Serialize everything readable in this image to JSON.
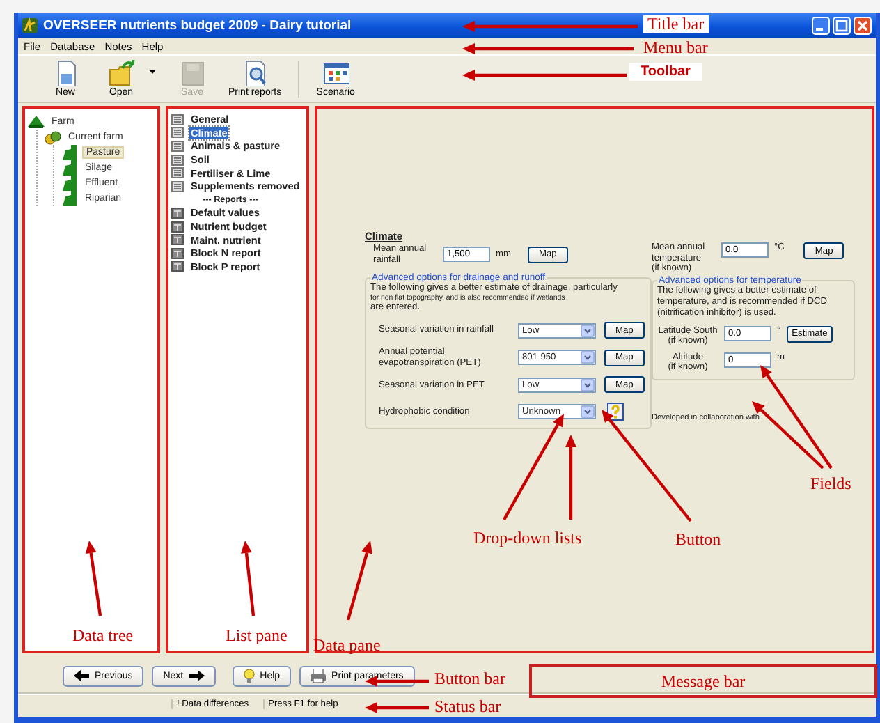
{
  "window": {
    "title": "OVERSEER nutrients budget 2009 - Dairy tutorial"
  },
  "menu": [
    "File",
    "Database",
    "Notes",
    "Help"
  ],
  "toolbar": [
    {
      "label": "New",
      "kind": "new",
      "disabled": false
    },
    {
      "label": "Open",
      "kind": "open",
      "disabled": false,
      "dropdown": true
    },
    {
      "label": "Save",
      "kind": "save",
      "disabled": true
    },
    {
      "label": "Print reports",
      "kind": "print",
      "disabled": false
    },
    {
      "label": "Scenario",
      "kind": "scenario",
      "disabled": false
    }
  ],
  "data_tree": [
    {
      "label": "Farm",
      "kind": "farm",
      "selected": false,
      "children": [
        {
          "label": "Current farm",
          "kind": "group",
          "selected": false,
          "children": [
            {
              "label": "Pasture",
              "kind": "block",
              "selected": true
            },
            {
              "label": "Silage",
              "kind": "block",
              "selected": false
            },
            {
              "label": "Effluent",
              "kind": "block",
              "selected": false
            },
            {
              "label": "Riparian",
              "kind": "block",
              "selected": false
            }
          ]
        }
      ]
    }
  ],
  "list_pane": [
    {
      "label": "General",
      "kind": "page",
      "selected": false
    },
    {
      "label": "Climate",
      "kind": "page",
      "selected": true
    },
    {
      "label": "Animals & pasture",
      "kind": "page",
      "selected": false
    },
    {
      "label": "Soil",
      "kind": "page",
      "selected": false
    },
    {
      "label": "Fertiliser & Lime",
      "kind": "page",
      "selected": false
    },
    {
      "label": "Supplements removed",
      "kind": "page",
      "selected": false
    },
    {
      "label": "--- Reports ---",
      "kind": "heading",
      "selected": false
    },
    {
      "label": "Default values",
      "kind": "report",
      "selected": false
    },
    {
      "label": "Nutrient budget",
      "kind": "report",
      "selected": false
    },
    {
      "label": "Maint. nutrient",
      "kind": "report",
      "selected": false
    },
    {
      "label": "Block N report",
      "kind": "report",
      "selected": false
    },
    {
      "label": "Block P report",
      "kind": "report",
      "selected": false
    }
  ],
  "data_pane": {
    "section_title": "Climate",
    "rainfall": {
      "label": "Mean annual rainfall",
      "value": "1,500",
      "unit": "mm",
      "button": "Map"
    },
    "drainage": {
      "legend": "Advanced options for drainage and runoff",
      "intro": "The following gives a better estimate of drainage, particularly",
      "intro_small": "for non flat topography, and is also recommended if wetlands",
      "intro_end": "are entered.",
      "rows": [
        {
          "label": "Seasonal variation in rainfall",
          "value": "Low",
          "kind": "map",
          "button": "Map"
        },
        {
          "label": "Annual potential evapotranspiration (PET)",
          "value": "801-950",
          "kind": "map",
          "button": "Map"
        },
        {
          "label": "Seasonal variation in PET",
          "value": "Low",
          "kind": "map",
          "button": "Map"
        },
        {
          "label": "Hydrophobic condition",
          "value": "Unknown",
          "kind": "help"
        }
      ]
    },
    "temperature": {
      "label": "Mean annual temperature",
      "note": "(if known)",
      "value": "0.0",
      "unit": "°C",
      "button": "Map"
    },
    "temperature_options": {
      "legend": "Advanced options for temperature",
      "intro": "The following gives a better estimate of temperature, and is recommended if DCD (nitrification inhibitor) is used.",
      "latitude": {
        "label": "Latitude South",
        "note": "(if known)",
        "value": "0.0",
        "unit": "°",
        "button": "Estimate"
      },
      "altitude": {
        "label": "Altitude",
        "note": "(if known)",
        "value": "0",
        "unit": "m"
      }
    },
    "credit": "Developed in collaboration with"
  },
  "button_bar": [
    {
      "label": "Previous",
      "kind": "previous"
    },
    {
      "label": "Next",
      "kind": "next"
    },
    {
      "label": "Help",
      "kind": "help"
    },
    {
      "label": "Print parameters",
      "kind": "print"
    }
  ],
  "status_bar": [
    "! Data differences",
    "Press F1 for help"
  ],
  "annotations": [
    {
      "label": "Title bar",
      "kind": "callout"
    },
    {
      "label": "Menu bar",
      "kind": "callout"
    },
    {
      "label": "Toolbar",
      "kind": "callout"
    },
    {
      "label": "Data tree",
      "kind": "callout"
    },
    {
      "label": "List pane",
      "kind": "callout"
    },
    {
      "label": "Data pane",
      "kind": "callout"
    },
    {
      "label": "Drop-down lists",
      "kind": "callout"
    },
    {
      "label": "Button",
      "kind": "callout"
    },
    {
      "label": "Fields",
      "kind": "callout"
    },
    {
      "label": "Message bar",
      "kind": "region"
    },
    {
      "label": "Button bar",
      "kind": "callout"
    },
    {
      "label": "Status bar",
      "kind": "callout"
    }
  ]
}
